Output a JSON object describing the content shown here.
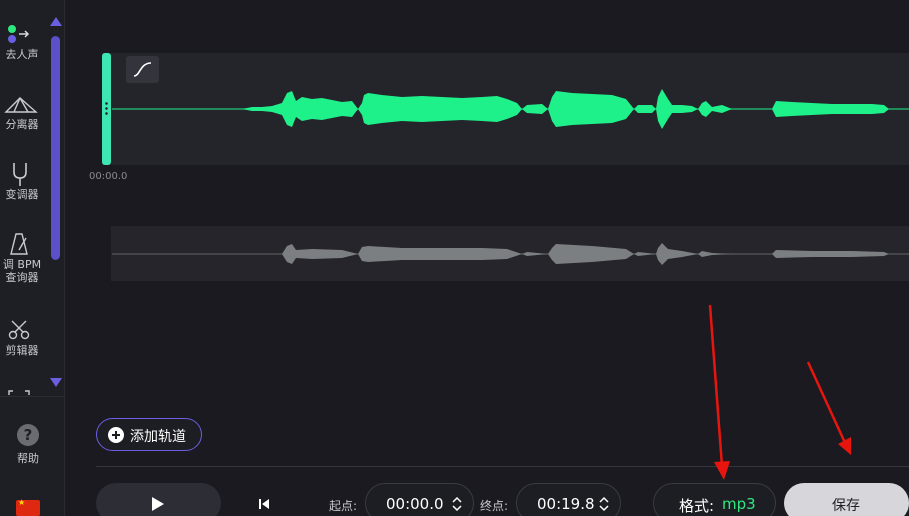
{
  "sidebar": {
    "tools": [
      {
        "label": "去人声",
        "icon": "vocal-remover-icon"
      },
      {
        "label": "分离器",
        "icon": "splitter-icon"
      },
      {
        "label": "变调器",
        "icon": "tuning-fork-icon"
      },
      {
        "label": "调 BPM",
        "icon": "metronome-icon"
      },
      {
        "label": "查询器",
        "icon": "metronome-icon"
      },
      {
        "label": "剪辑器",
        "icon": "scissors-icon"
      }
    ],
    "help_label": "帮助"
  },
  "timeline": {
    "start_time_label": "00:00.0"
  },
  "controls": {
    "add_track_label": "添加轨道",
    "start_label": "起点:",
    "start_value": "00:00.0",
    "end_label": "终点:",
    "end_value": "00:19.8",
    "format_label": "格式:",
    "format_value": "mp3",
    "save_label": "保存"
  },
  "colors": {
    "accent": "#6a5fe0",
    "wave_active": "#1ef08a",
    "wave_inactive": "#7c7f81",
    "handle": "#3ee6b4",
    "annotation_arrow": "#e8150f"
  }
}
